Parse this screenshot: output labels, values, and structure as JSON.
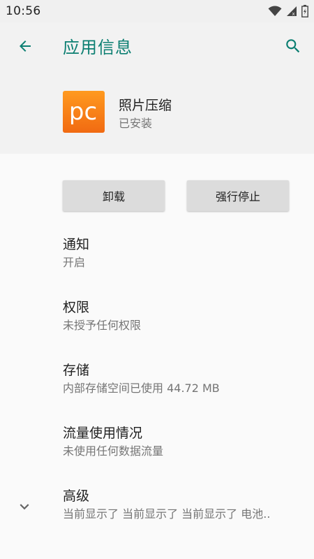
{
  "status_bar": {
    "time": "10:56"
  },
  "header": {
    "title": "应用信息",
    "app_name": "照片压缩",
    "app_status": "已安装",
    "app_icon_text": "pc"
  },
  "buttons": {
    "uninstall": "卸载",
    "force_stop": "强行停止"
  },
  "items": [
    {
      "title": "通知",
      "subtitle": "开启"
    },
    {
      "title": "权限",
      "subtitle": "未授予任何权限"
    },
    {
      "title": "存储",
      "subtitle": "内部存储空间已使用 44.72 MB"
    },
    {
      "title": "流量使用情况",
      "subtitle": "未使用任何数据流量"
    },
    {
      "title": "高级",
      "subtitle": "当前显示了 当前显示了 当前显示了 电池.."
    }
  ],
  "colors": {
    "accent": "#0c7f72",
    "icon_orange": "#f7821a"
  },
  "icons": [
    "back-arrow-icon",
    "search-icon",
    "wifi-icon",
    "signal-icon",
    "battery-icon",
    "chevron-down-icon"
  ]
}
